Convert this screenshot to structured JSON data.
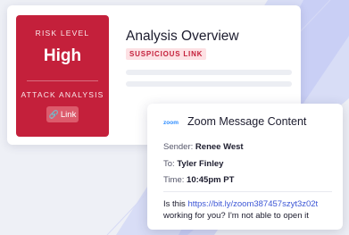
{
  "risk_panel": {
    "risk_label": "RISK LEVEL",
    "risk_value": "High",
    "attack_label": "ATTACK ANALYSIS",
    "link_button": "Link",
    "color": "#c4203b"
  },
  "overview": {
    "title": "Analysis Overview",
    "badge": "SUSPICIOUS LINK"
  },
  "zoom_card": {
    "logo": "zoom",
    "title": "Zoom Message Content",
    "sender_label": "Sender:",
    "sender_value": "Renee West",
    "to_label": "To:",
    "to_value": "Tyler Finley",
    "time_label": "Time:",
    "time_value": "10:45pm PT",
    "message_prefix": "Is this ",
    "message_link": "https://bit.ly/zoom387457szyt3z02t",
    "message_line2": "working for you? I'm not able to open it"
  },
  "icons": {
    "link": "link-icon"
  },
  "colors": {
    "accent": "#c4203b",
    "badge_bg": "#fde1e4",
    "link": "#3d57d6",
    "zoom_blue": "#2d8cff"
  }
}
